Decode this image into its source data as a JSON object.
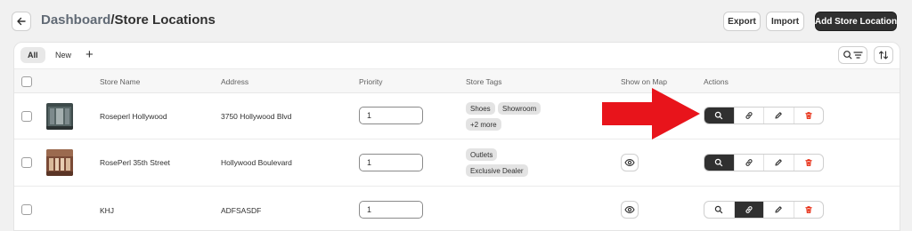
{
  "header": {
    "title_prefix": "Dashboard",
    "separator": "/",
    "title_main": "Store Locations",
    "export_label": "Export",
    "import_label": "Import",
    "add_label": "Add Store Location"
  },
  "tabs": {
    "items": [
      {
        "label": "All",
        "active": true
      },
      {
        "label": "New",
        "active": false
      }
    ],
    "add_symbol": "+"
  },
  "columns": {
    "store_name": "Store Name",
    "address": "Address",
    "priority": "Priority",
    "store_tags": "Store Tags",
    "show_on_map": "Show on Map",
    "actions": "Actions"
  },
  "rows": [
    {
      "name": "Roseperl Hollywood",
      "address": "3750 Hollywood Blvd",
      "priority": "1",
      "tags": [
        "Shoes",
        "Showroom",
        "+2 more"
      ],
      "show_on_map": false,
      "active_action": "search"
    },
    {
      "name": "RosePerl 35th Street",
      "address": "Hollywood Boulevard",
      "priority": "1",
      "tags": [
        "Outlets",
        "Exclusive Dealer"
      ],
      "show_on_map": true,
      "active_action": "search"
    },
    {
      "name": "KHJ",
      "address": "ADFSASDF",
      "priority": "1",
      "tags": [],
      "show_on_map": true,
      "active_action": "link"
    }
  ],
  "icons": {
    "back": "arrow-left-icon",
    "search_filter": "search-filter-icon",
    "sort": "sort-icon",
    "eye": "eye-icon",
    "search": "search-icon",
    "link": "link-icon",
    "edit": "pencil-icon",
    "delete": "trash-icon",
    "annotation_arrow": "red-arrow-icon"
  },
  "colors": {
    "primary_dark": "#303030",
    "delete_red": "#e51c00",
    "arrow_red": "#e8141b",
    "page_bg": "#f1f1f1"
  }
}
